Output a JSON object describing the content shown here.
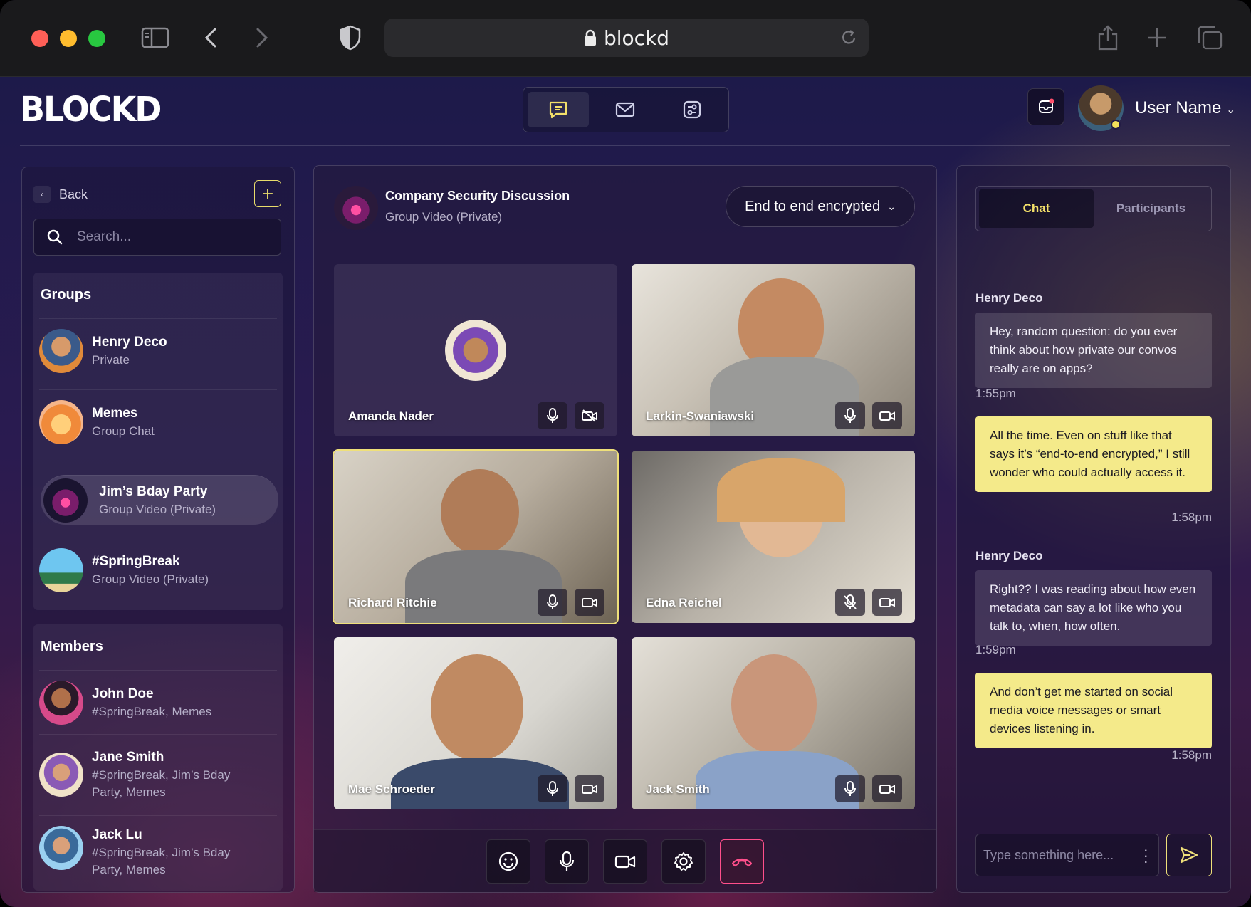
{
  "browser": {
    "url": "blockd",
    "icons": [
      "sidebar-icon",
      "back-icon",
      "forward-icon",
      "shield-icon",
      "lock-icon",
      "reload-icon",
      "share-icon",
      "new-tab-icon",
      "tabs-icon"
    ]
  },
  "header": {
    "logo": "BLOCKD",
    "nav": [
      "chat-icon",
      "mail-icon",
      "settings-sliders-icon"
    ],
    "user_name": "User Name"
  },
  "sidebar": {
    "back_label": "Back",
    "search_placeholder": "Search...",
    "groups_title": "Groups",
    "groups": [
      {
        "name": "Henry Deco",
        "sub": "Private"
      },
      {
        "name": "Memes",
        "sub": "Group Chat"
      },
      {
        "name": "Jim’s Bday Party",
        "sub": "Group Video (Private)"
      },
      {
        "name": "#SpringBreak",
        "sub": "Group Video (Private)"
      }
    ],
    "members_title": "Members",
    "members": [
      {
        "name": "John Doe",
        "sub": "#SpringBreak, Memes"
      },
      {
        "name": "Jane Smith",
        "sub": "#SpringBreak, Jim’s Bday Party, Memes"
      },
      {
        "name": "Jack Lu",
        "sub": "#SpringBreak, Jim’s Bday Party, Memes"
      }
    ]
  },
  "call": {
    "title": "Company Security Discussion",
    "subtitle": "Group Video (Private)",
    "encryption": "End to end encrypted",
    "participants": [
      {
        "name": "Amanda Nader",
        "mic": "on",
        "camera": "off"
      },
      {
        "name": "Larkin-Swaniawski",
        "mic": "on",
        "camera": "on"
      },
      {
        "name": "Richard Ritchie",
        "mic": "on",
        "camera": "on"
      },
      {
        "name": "Edna Reichel",
        "mic": "off",
        "camera": "on"
      },
      {
        "name": "Mae Schroeder",
        "mic": "on",
        "camera": "on"
      },
      {
        "name": "Jack Smith",
        "mic": "on",
        "camera": "on"
      }
    ],
    "controls": [
      "emoji-icon",
      "mic-icon",
      "camera-icon",
      "settings-icon",
      "end-call-icon"
    ]
  },
  "chat": {
    "tabs": [
      "Chat",
      "Participants"
    ],
    "active_tab": "Chat",
    "messages": [
      {
        "sender": "Henry Deco",
        "text": "Hey, random question: do you ever think about how private our convos really are on apps?",
        "time": "1:55pm",
        "dir": "in"
      },
      {
        "sender": "",
        "text": "All the time. Even on stuff like that says it’s “end-to-end encrypted,” I still wonder who could actually access it.",
        "time": "1:58pm",
        "dir": "out"
      },
      {
        "sender": "Henry Deco",
        "text": "Right?? I was reading about how even metadata can say a lot like who you talk to, when, how often.",
        "time": "1:59pm",
        "dir": "in"
      },
      {
        "sender": "",
        "text": "And don’t get me started on social media voice messages or smart devices listening in.",
        "time": "1:58pm",
        "dir": "out"
      }
    ],
    "input_placeholder": "Type something here..."
  },
  "colors": {
    "accent": "#f3e06a",
    "danger": "#ff4f8b"
  }
}
